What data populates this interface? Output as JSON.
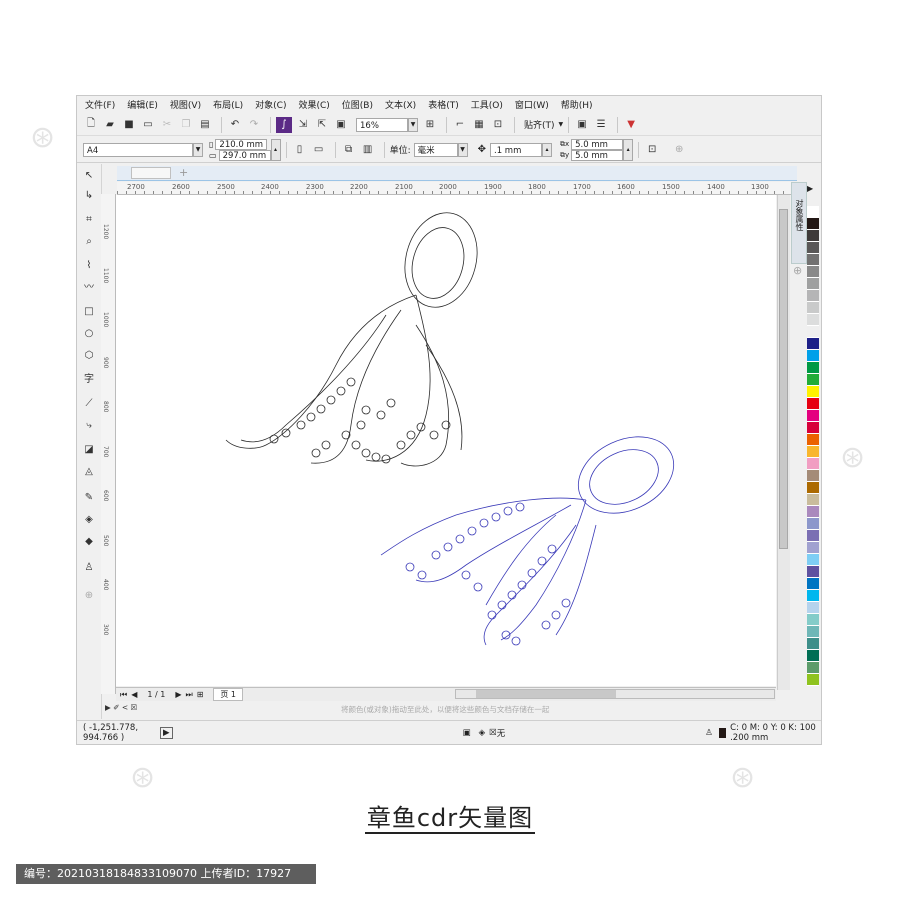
{
  "menu": [
    "文件(F)",
    "编辑(E)",
    "视图(V)",
    "布局(L)",
    "对象(C)",
    "效果(C)",
    "位图(B)",
    "文本(X)",
    "表格(T)",
    "工具(O)",
    "窗口(W)",
    "帮助(H)"
  ],
  "toolbar": {
    "zoom": "16%",
    "snap_label": "贴齐(T)"
  },
  "propertybar": {
    "page_size": "A4",
    "width": "210.0 mm",
    "height": "297.0 mm",
    "unit_label": "单位:",
    "unit_value": "毫米",
    "nudge": ".1 mm",
    "dup_x": "5.0 mm",
    "dup_y": "5.0 mm"
  },
  "ruler": {
    "top": [
      "2700",
      "2600",
      "2500",
      "2400",
      "2300",
      "2200",
      "2100",
      "2000",
      "1900",
      "1800",
      "1700",
      "1600",
      "1500",
      "1400",
      "1300"
    ],
    "left": [
      "1200",
      "1100",
      "1000",
      "900",
      "800",
      "700",
      "600",
      "500",
      "400",
      "300"
    ]
  },
  "docker_label": "对象属性",
  "page_nav": {
    "count": "1 / 1",
    "tab": "页 1"
  },
  "color_hint": "将颜色(或对象)拖动至此处，以便将这些颜色与文档存储在一起",
  "status": {
    "coords": "( -1,251.778, 994.766 )",
    "fill_none": "无",
    "outline": "C: 0 M: 0 Y: 0 K: 100  .200 mm"
  },
  "palette": [
    "#ffffff",
    "#231815",
    "#3e3a39",
    "#595757",
    "#727171",
    "#898989",
    "#9fa0a0",
    "#b5b5b6",
    "#c9caca",
    "#dcdddd",
    "#efefef",
    "#1d2088",
    "#00a0e9",
    "#009944",
    "#22ac38",
    "#fff100",
    "#e60012",
    "#e4007f",
    "#d7003a",
    "#eb6100",
    "#f8b62d",
    "#f19ec2",
    "#a48b78",
    "#ac6a00",
    "#c9bc9c",
    "#aa89bd",
    "#8c97cb",
    "#7b6fb3",
    "#a1a1d0",
    "#7ecef4",
    "#5f52a0",
    "#0075c2",
    "#00b7ee",
    "#b5d3ed",
    "#84ccc9",
    "#6fb7b7",
    "#3e8f8a",
    "#006e54",
    "#5c9c6a",
    "#8fc31f"
  ],
  "colors": {
    "octopus_black": "#2a2a2a",
    "octopus_blue": "#3a3ab8"
  },
  "caption": "章鱼cdr矢量图",
  "id_bar": "编号：20210318184833109070 上传者ID：17927"
}
